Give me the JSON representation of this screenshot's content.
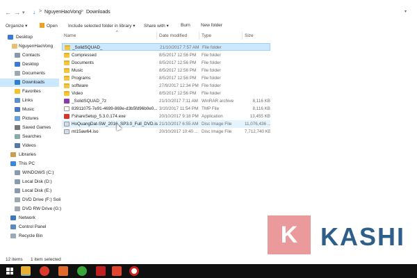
{
  "address": {
    "crumbs": [
      "NguyenHaoVong",
      "Downloads"
    ],
    "separator": ">"
  },
  "toolbar": {
    "organize": "Organize ▾",
    "open": "Open",
    "include": "Include selected folder in library ▾",
    "share": "Share with ▾",
    "burn": "Burn",
    "new_folder": "New folder"
  },
  "nav": [
    {
      "label": "Desktop",
      "icon": "desktop-icon"
    },
    {
      "label": "NguyenHaoVong",
      "icon": "user-folder-icon"
    },
    {
      "label": "Contacts",
      "icon": "contacts-icon"
    },
    {
      "label": "Desktop",
      "icon": "desktop-icon"
    },
    {
      "label": "Documents",
      "icon": "documents-icon"
    },
    {
      "label": "Downloads",
      "icon": "downloads-icon"
    },
    {
      "label": "Favorites",
      "icon": "star-icon"
    },
    {
      "label": "Links",
      "icon": "links-icon"
    },
    {
      "label": "Music",
      "icon": "music-icon"
    },
    {
      "label": "Pictures",
      "icon": "pictures-icon"
    },
    {
      "label": "Saved Games",
      "icon": "games-icon"
    },
    {
      "label": "Searches",
      "icon": "search-icon"
    },
    {
      "label": "Videos",
      "icon": "videos-icon"
    },
    {
      "label": "Libraries",
      "icon": "libraries-icon"
    },
    {
      "label": "This PC",
      "icon": "pc-icon"
    },
    {
      "label": "WINDOWS (C:)",
      "icon": "drive-icon"
    },
    {
      "label": "Local Disk (D:)",
      "icon": "drive-icon"
    },
    {
      "label": "Local Disk (E:)",
      "icon": "drive-icon"
    },
    {
      "label": "DVD Drive (F:) Soli",
      "icon": "dvd-icon"
    },
    {
      "label": "DVD RW Drive (G:)",
      "icon": "dvd-icon"
    },
    {
      "label": "Network",
      "icon": "network-icon"
    },
    {
      "label": "Control Panel",
      "icon": "control-panel-icon"
    },
    {
      "label": "Recycle Bin",
      "icon": "recycle-bin-icon"
    }
  ],
  "columns": {
    "name": "Name",
    "date": "Date modified",
    "type": "Type",
    "size": "Size"
  },
  "files": [
    {
      "name": "_SolidSQUAD_",
      "date": "21/10/2017 7:57 AM",
      "type": "File folder",
      "size": "",
      "kind": "folder"
    },
    {
      "name": "Compressed",
      "date": "8/5/2017 12:56 PM",
      "type": "File folder",
      "size": "",
      "kind": "folder"
    },
    {
      "name": "Documents",
      "date": "8/5/2017 12:56 PM",
      "type": "File folder",
      "size": "",
      "kind": "folder"
    },
    {
      "name": "Music",
      "date": "8/5/2017 12:56 PM",
      "type": "File folder",
      "size": "",
      "kind": "folder"
    },
    {
      "name": "Programs",
      "date": "8/5/2017 12:56 PM",
      "type": "File folder",
      "size": "",
      "kind": "folder"
    },
    {
      "name": "software",
      "date": "27/9/2017 12:34 PM",
      "type": "File folder",
      "size": "",
      "kind": "folder"
    },
    {
      "name": "Video",
      "date": "8/5/2017 12:56 PM",
      "type": "File folder",
      "size": "",
      "kind": "folder"
    },
    {
      "name": "_SolidSQUAD_7z",
      "date": "21/10/2017 7:11 AM",
      "type": "WinRAR archive",
      "size": "8,116 KB",
      "kind": "rar"
    },
    {
      "name": "83911075-7e91-4699-869e-d3b5fd96b0e0...",
      "date": "3/10/2017 11:54 PM",
      "type": "TMP File",
      "size": "8,116 KB",
      "kind": "filew"
    },
    {
      "name": "FshareSetup_5.3.0.174.exe",
      "date": "20/10/2017 9:18 PM",
      "type": "Application",
      "size": "13,455 KB",
      "kind": "exe"
    },
    {
      "name": "HoQuangDat-SW_2016_SP3.0_Full_DVD.iso",
      "date": "21/10/2017 6:55 AM",
      "type": "Disc Image File",
      "size": "11,076,436 ...",
      "kind": "iso"
    },
    {
      "name": "ml15aw64.iso",
      "date": "20/10/2017 10:40 ...",
      "type": "Disc Image File",
      "size": "7,712,740 KB",
      "kind": "iso"
    }
  ],
  "status": {
    "count": "12 items",
    "selected": "1 item selected"
  },
  "taskbar": [
    "start-icon",
    "file-explorer-icon",
    "chrome-icon",
    "media-icon",
    "utorrent-icon",
    "app-icon",
    "recorder-icon",
    "record-icon"
  ],
  "logo": {
    "letter": "K",
    "text": "KASHI"
  },
  "colors": {
    "selection": "#cce8ff",
    "folder": "#f4c542",
    "logo_box": "#e8888b",
    "logo_text": "#2d5f8a"
  }
}
